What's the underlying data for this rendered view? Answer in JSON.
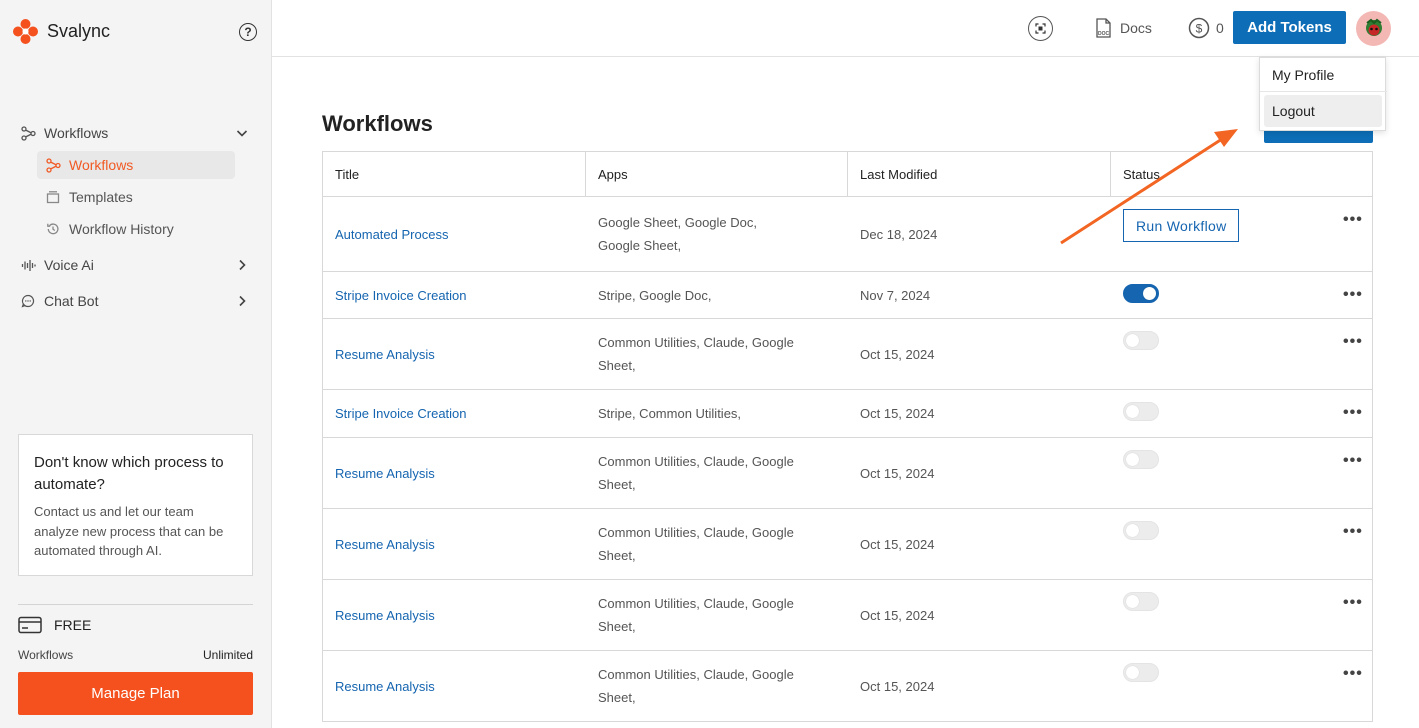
{
  "brand": {
    "name": "Svalync"
  },
  "sidebar": {
    "help_icon_text": "?",
    "groups": [
      {
        "label": "Workflows",
        "icon": "workflow-icon",
        "expanded": true
      },
      {
        "label": "Voice Ai",
        "icon": "audio-wave-icon",
        "expanded": false
      },
      {
        "label": "Chat Bot",
        "icon": "chat-icon",
        "expanded": false
      }
    ],
    "workflow_items": [
      {
        "label": "Workflows",
        "icon": "workflow-icon",
        "active": true
      },
      {
        "label": "Templates",
        "icon": "template-icon",
        "active": false
      },
      {
        "label": "Workflow History",
        "icon": "history-icon",
        "active": false
      }
    ],
    "promo": {
      "title": "Don't know which process to automate?",
      "body": "Contact us and let our team analyze new process that can be automated through AI."
    },
    "plan": {
      "name": "FREE",
      "workflows_label": "Workflows",
      "workflows_value": "Unlimited",
      "manage_label": "Manage Plan"
    }
  },
  "header": {
    "docs_label": "Docs",
    "tokens_count": "0",
    "add_tokens_label": "Add Tokens"
  },
  "profile_menu": {
    "items": [
      "My Profile",
      "Logout"
    ],
    "hovered": "Logout"
  },
  "main": {
    "title": "Workflows",
    "columns": [
      "Title",
      "Apps",
      "Last Modified",
      "Status"
    ],
    "run_workflow_label": "Run Workflow",
    "rows": [
      {
        "title": "Automated Process",
        "apps": "Google Sheet, Google Doc, Google Sheet,",
        "modified": "Dec 18, 2024",
        "status": "run"
      },
      {
        "title": "Stripe Invoice Creation",
        "apps": "Stripe, Google Doc,",
        "modified": "Nov 7, 2024",
        "status": "on"
      },
      {
        "title": "Resume Analysis",
        "apps": "Common Utilities, Claude, Google Sheet,",
        "modified": "Oct 15, 2024",
        "status": "off"
      },
      {
        "title": "Stripe Invoice Creation",
        "apps": "Stripe, Common Utilities,",
        "modified": "Oct 15, 2024",
        "status": "off"
      },
      {
        "title": "Resume Analysis",
        "apps": "Common Utilities, Claude, Google Sheet,",
        "modified": "Oct 15, 2024",
        "status": "off"
      },
      {
        "title": "Resume Analysis",
        "apps": "Common Utilities, Claude, Google Sheet,",
        "modified": "Oct 15, 2024",
        "status": "off"
      },
      {
        "title": "Resume Analysis",
        "apps": "Common Utilities, Claude, Google Sheet,",
        "modified": "Oct 15, 2024",
        "status": "off"
      },
      {
        "title": "Resume Analysis",
        "apps": "Common Utilities, Claude, Google Sheet,",
        "modified": "Oct 15, 2024",
        "status": "off"
      }
    ]
  },
  "colors": {
    "brand_orange": "#f4511e",
    "primary_blue": "#0d6eb7",
    "link_blue": "#1565b0"
  }
}
